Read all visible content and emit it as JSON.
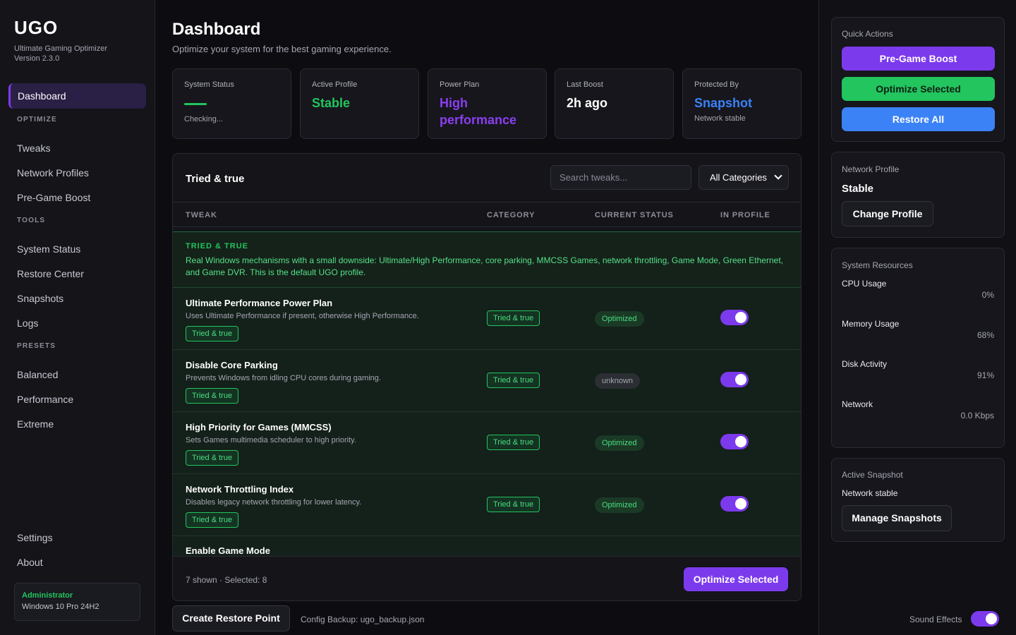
{
  "app": {
    "name": "UGO",
    "subtitle": "Ultimate Gaming Optimizer",
    "version": "Version 2.3.0"
  },
  "sidebar": {
    "active": "Dashboard",
    "sections": [
      {
        "title": "OPTIMIZE",
        "items": [
          "Tweaks",
          "Network Profiles",
          "Pre-Game Boost"
        ]
      },
      {
        "title": "TOOLS",
        "items": [
          "System Status",
          "Restore Center",
          "Snapshots",
          "Logs"
        ]
      },
      {
        "title": "PRESETS",
        "items": [
          "Balanced",
          "Performance",
          "Extreme"
        ]
      }
    ],
    "bottom": [
      "Settings",
      "About"
    ],
    "user": {
      "role": "Administrator",
      "os": "Windows 10 Pro 24H2"
    }
  },
  "header": {
    "title": "Dashboard",
    "subtitle": "Optimize your system for the best gaming experience."
  },
  "stats": [
    {
      "label": "System Status",
      "value": "",
      "note": "Checking...",
      "color": "#22c55e"
    },
    {
      "label": "Active Profile",
      "value": "Stable",
      "note": "",
      "color": "#22c55e"
    },
    {
      "label": "Power Plan",
      "value": "High performance",
      "note": "",
      "color": "#8b3ef0"
    },
    {
      "label": "Last Boost",
      "value": "2h ago",
      "note": "",
      "color": "#ffffff"
    },
    {
      "label": "Protected By",
      "value": "Snapshot",
      "note": "Network stable",
      "color": "#3b82f6"
    }
  ],
  "tweaks": {
    "title": "Tried & true",
    "search_placeholder": "Search tweaks...",
    "category_filter": "All Categories",
    "columns": [
      "TWEAK",
      "CATEGORY",
      "CURRENT STATUS",
      "IN PROFILE"
    ],
    "banner": {
      "title": "TRIED & TRUE",
      "text": "Real Windows mechanisms with a small downside: Ultimate/High Performance, core parking, MMCSS Games, network throttling, Game Mode, Green Ethernet, and Game DVR. This is the default UGO profile."
    },
    "rows": [
      {
        "name": "Ultimate Performance Power Plan",
        "desc": "Uses Ultimate Performance if present, otherwise High Performance.",
        "tag": "Tried & true",
        "category": "Tried & true",
        "status": "Optimized",
        "in_profile": true
      },
      {
        "name": "Disable Core Parking",
        "desc": "Prevents Windows from idling CPU cores during gaming.",
        "tag": "Tried & true",
        "category": "Tried & true",
        "status": "unknown",
        "in_profile": true
      },
      {
        "name": "High Priority for Games (MMCSS)",
        "desc": "Sets Games multimedia scheduler to high priority.",
        "tag": "Tried & true",
        "category": "Tried & true",
        "status": "Optimized",
        "in_profile": true
      },
      {
        "name": "Network Throttling Index",
        "desc": "Disables legacy network throttling for lower latency.",
        "tag": "Tried & true",
        "category": "Tried & true",
        "status": "Optimized",
        "in_profile": true
      },
      {
        "name": "Enable Game Mode"
      }
    ],
    "footer_text": "7 shown · Selected: 8",
    "optimize_button": "Optimize Selected"
  },
  "bottom_bar": {
    "restore_button": "Create Restore Point",
    "backup": "Config Backup: ugo_backup.json",
    "sound_label": "Sound Effects",
    "sound_on": true
  },
  "quick_actions": {
    "title": "Quick Actions",
    "buttons": [
      "Pre-Game Boost",
      "Optimize Selected",
      "Restore All"
    ]
  },
  "network_profile": {
    "title": "Network Profile",
    "value": "Stable",
    "button": "Change Profile"
  },
  "resources": {
    "title": "System Resources",
    "items": [
      {
        "label": "CPU Usage",
        "value": "0%"
      },
      {
        "label": "Memory Usage",
        "value": "68%"
      },
      {
        "label": "Disk Activity",
        "value": "91%"
      },
      {
        "label": "Network",
        "value": "0.0 Kbps"
      }
    ]
  },
  "snapshot": {
    "title": "Active Snapshot",
    "value": "Network stable",
    "button": "Manage Snapshots"
  }
}
